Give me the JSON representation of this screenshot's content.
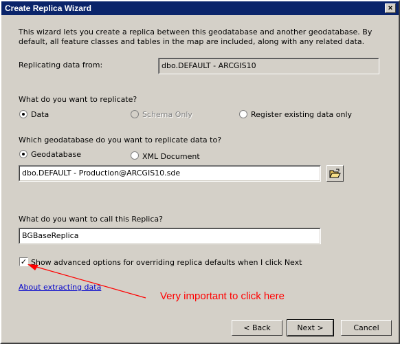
{
  "window": {
    "title": "Create Replica Wizard",
    "close_glyph": "×"
  },
  "intro_text": "This wizard lets you create a replica between this geodatabase  and another geodatabase. By default, all feature classes and tables in the map are included, along with any related data.",
  "source": {
    "label": "Replicating data from:",
    "value": "dbo.DEFAULT - ARCGIS10"
  },
  "replicate_what": {
    "question": "What do you want to replicate?",
    "options": [
      {
        "label": "Data",
        "selected": true,
        "enabled": true
      },
      {
        "label": "Schema Only",
        "selected": false,
        "enabled": false
      },
      {
        "label": "Register existing data only",
        "selected": false,
        "enabled": true
      }
    ]
  },
  "target": {
    "question": "Which geodatabase do you want to replicate data to?",
    "options": [
      {
        "label": "Geodatabase",
        "selected": true
      },
      {
        "label": "XML Document",
        "selected": false
      }
    ],
    "path_value": "dbo.DEFAULT - Production@ARCGIS10.sde",
    "browse_icon": "folder-open-icon"
  },
  "replica_name": {
    "question": "What do you want to call this Replica?",
    "value": "BGBaseReplica"
  },
  "advanced": {
    "label": "Show advanced options for overriding replica defaults when I click Next",
    "checked": true,
    "check_glyph": "✓"
  },
  "about_link": "About extracting data",
  "annotation": {
    "text": "Very important to click here",
    "color": "#ff0000"
  },
  "buttons": {
    "back": "< Back",
    "next": "Next >",
    "cancel": "Cancel"
  }
}
